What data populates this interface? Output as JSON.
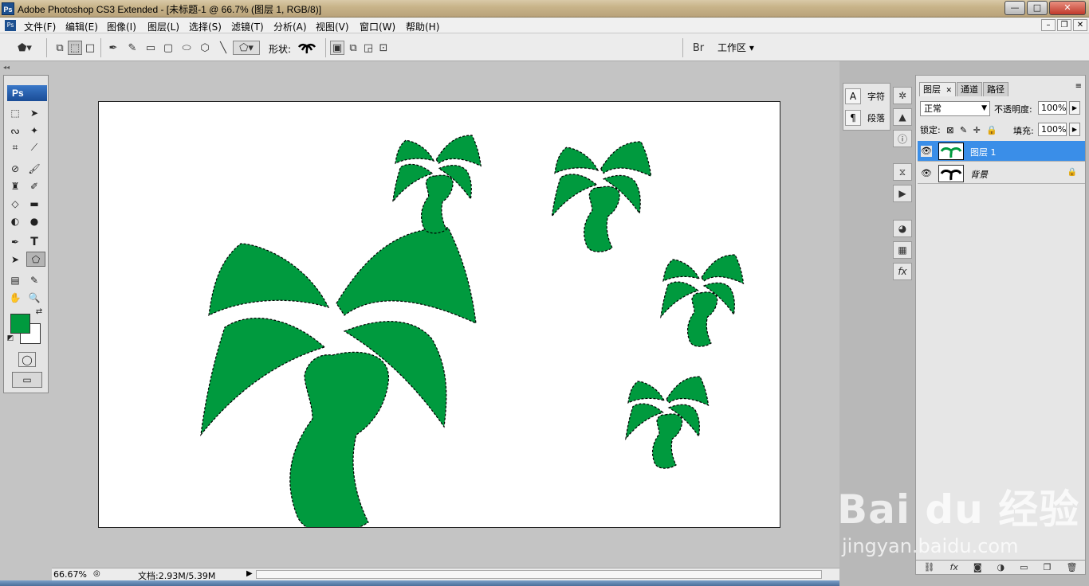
{
  "window": {
    "title": "Adobe Photoshop CS3 Extended - [未标题-1 @ 66.7% (图层 1, RGB/8)]",
    "app_icon": "Ps",
    "controls": [
      "—",
      "□",
      "✕"
    ]
  },
  "menubar": {
    "doc_icon": "Ps",
    "items": [
      "文件(F)",
      "编辑(E)",
      "图像(I)",
      "图层(L)",
      "选择(S)",
      "滤镜(T)",
      "分析(A)",
      "视图(V)",
      "窗口(W)",
      "帮助(H)"
    ]
  },
  "options": {
    "shape_label": "形状:",
    "workspace_label": "工作区 ▾",
    "icons": [
      "shape-tool-icon",
      "shape-layers-icon",
      "paths-icon",
      "fill-pixels-icon",
      "pen-icon",
      "freeform-pen-icon",
      "rectangle-icon",
      "rounded-rect-icon",
      "ellipse-icon",
      "polygon-icon",
      "line-icon",
      "custom-shape-icon",
      "palm-tree-shape-icon",
      "new-layer-mode-icon",
      "add-mode-icon",
      "subtract-mode-icon",
      "intersect-mode-icon",
      "bridge-icon"
    ]
  },
  "toolbox": {
    "badge": "Ps",
    "collapse": "◂◂",
    "fg_color": "#009a3e",
    "bg_color": "#ffffff"
  },
  "canvas": {
    "fill_color": "#009a3e"
  },
  "status": {
    "zoom": "66.67%",
    "doc_info": "文档:2.93M/5.39M"
  },
  "right_panels": {
    "char_panel": [
      {
        "icon": "A",
        "label": "字符"
      },
      {
        "icon": "¶",
        "label": "段落"
      }
    ],
    "dock_icons": [
      "navigator-icon",
      "histogram-icon",
      "info-icon",
      "history-icon",
      "actions-icon",
      "color-icon",
      "swatches-icon",
      "styles-icon"
    ]
  },
  "layers": {
    "tabs": [
      "图层",
      "通道",
      "路径"
    ],
    "tab_close": "✕",
    "blend_mode": "正常",
    "opacity_label": "不透明度:",
    "opacity": "100%",
    "lock_label": "锁定:",
    "fill_label": "填充:",
    "fill": "100%",
    "rows": [
      {
        "name": "图层 1",
        "selected": true
      },
      {
        "name": "背景",
        "selected": false
      }
    ],
    "footer_icons": [
      "link-icon",
      "fx-icon",
      "mask-icon",
      "adjustment-icon",
      "group-icon",
      "new-layer-icon",
      "trash-icon"
    ]
  },
  "watermark": {
    "brand": "Bai du 经验",
    "url": "jingyan.baidu.com"
  }
}
